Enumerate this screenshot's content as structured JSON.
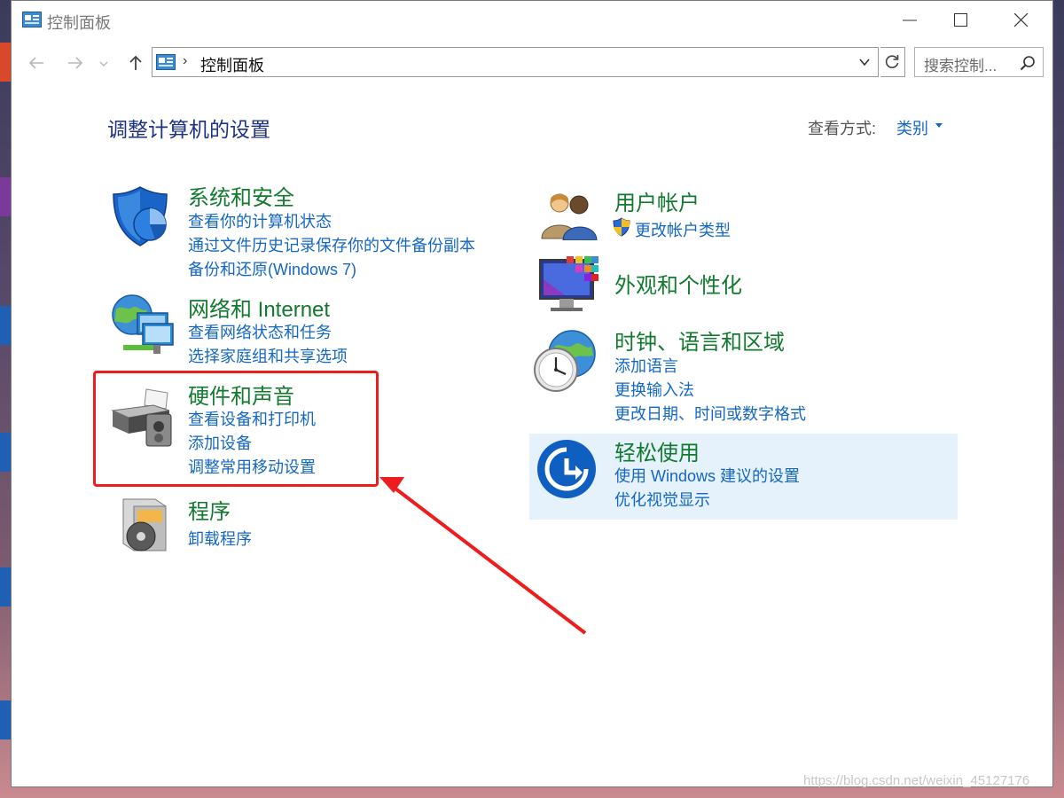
{
  "window": {
    "title": "控制面板"
  },
  "nav": {
    "address_path": "控制面板",
    "breadcrumb_sep": "›",
    "search_placeholder": "搜索控制..."
  },
  "page": {
    "title": "调整计算机的设置",
    "view_by_label": "查看方式:",
    "view_by_value": "类别"
  },
  "categories_left": [
    {
      "title": "系统和安全",
      "icon": "shield-icon",
      "links": [
        "查看你的计算机状态",
        "通过文件历史记录保存你的文件备份副本",
        "备份和还原(Windows 7)"
      ]
    },
    {
      "title": "网络和 Internet",
      "icon": "network-globe-icon",
      "links": [
        "查看网络状态和任务",
        "选择家庭组和共享选项"
      ]
    },
    {
      "title": "硬件和声音",
      "icon": "printer-speaker-icon",
      "links": [
        "查看设备和打印机",
        "添加设备",
        "调整常用移动设置"
      ]
    },
    {
      "title": "程序",
      "icon": "programs-disc-icon",
      "links": [
        "卸载程序"
      ]
    }
  ],
  "categories_right": [
    {
      "title": "用户帐户",
      "icon": "users-icon",
      "links": [
        "更改帐户类型"
      ]
    },
    {
      "title": "外观和个性化",
      "icon": "monitor-palette-icon",
      "links": []
    },
    {
      "title": "时钟、语言和区域",
      "icon": "clock-globe-icon",
      "links": [
        "添加语言",
        "更换输入法",
        "更改日期、时间或数字格式"
      ]
    },
    {
      "title": "轻松使用",
      "icon": "ease-of-access-icon",
      "links": [
        "使用 Windows 建议的设置",
        "优化视觉显示"
      ]
    }
  ],
  "annotation": {
    "highlight_color": "#ee1c1c"
  },
  "watermark": "https://blog.csdn.net/weixin_45127176"
}
